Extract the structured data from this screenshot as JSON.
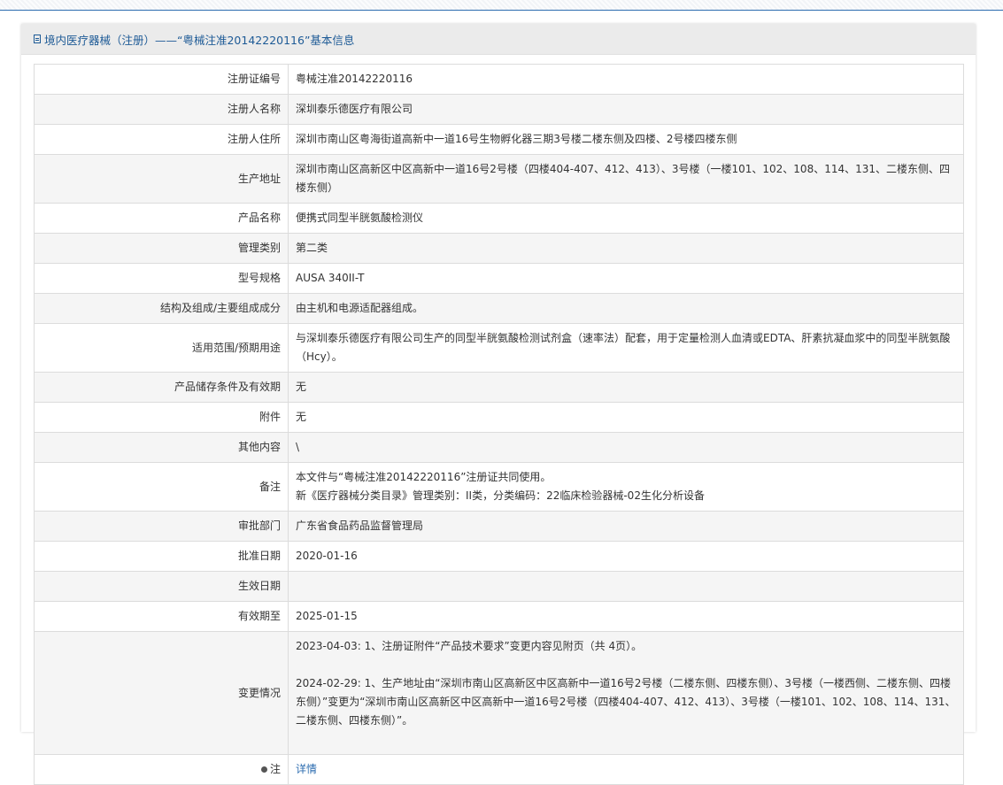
{
  "panel": {
    "title": "境内医疗器械（注册）——“粤械注准20142220116”基本信息"
  },
  "rows": [
    {
      "label": "注册证编号",
      "value": "粤械注准20142220116"
    },
    {
      "label": "注册人名称",
      "value": "深圳泰乐德医疗有限公司"
    },
    {
      "label": "注册人住所",
      "value": "深圳市南山区粤海街道高新中一道16号生物孵化器三期3号楼二楼东侧及四楼、2号楼四楼东侧"
    },
    {
      "label": "生产地址",
      "value": "深圳市南山区高新区中区高新中一道16号2号楼（四楼404-407、412、413）、3号楼（一楼101、102、108、114、131、二楼东侧、四楼东侧）"
    },
    {
      "label": "产品名称",
      "value": "便携式同型半胱氨酸检测仪"
    },
    {
      "label": "管理类别",
      "value": "第二类"
    },
    {
      "label": "型号规格",
      "value": "AUSA 340II-T"
    },
    {
      "label": "结构及组成/主要组成成分",
      "value": "由主机和电源适配器组成。"
    },
    {
      "label": "适用范围/预期用途",
      "value": "与深圳泰乐德医疗有限公司生产的同型半胱氨酸检测试剂盒（速率法）配套，用于定量检测人血清或EDTA、肝素抗凝血浆中的同型半胱氨酸（Hcy）。"
    },
    {
      "label": "产品储存条件及有效期",
      "value": "无"
    },
    {
      "label": "附件",
      "value": "无"
    },
    {
      "label": "其他内容",
      "value": "\\"
    }
  ],
  "remark": {
    "label": "备注",
    "line1": "本文件与“粤械注准20142220116”注册证共同使用。",
    "line2": "新《医疗器械分类目录》管理类别：II类，分类编码：22临床检验器械-02生化分析设备"
  },
  "rows2": [
    {
      "label": "审批部门",
      "value": "广东省食品药品监督管理局"
    },
    {
      "label": "批准日期",
      "value": "2020-01-16"
    },
    {
      "label": "生效日期",
      "value": ""
    },
    {
      "label": "有效期至",
      "value": "2025-01-15"
    }
  ],
  "changes": {
    "label": "变更情况",
    "items": [
      "2023-04-03: 1、注册证附件“产品技术要求”变更内容见附页（共 4页）。",
      "2024-02-29: 1、生产地址由“深圳市南山区高新区中区高新中一道16号2号楼（二楼东侧、四楼东侧）、3号楼（一楼西侧、二楼东侧、四楼东侧）”变更为“深圳市南山区高新区中区高新中一道16号2号楼（四楼404-407、412、413）、3号楼（一楼101、102、108、114、131、二楼东侧、四楼东侧）”。"
    ]
  },
  "note": {
    "label": "注",
    "link": "详情"
  }
}
